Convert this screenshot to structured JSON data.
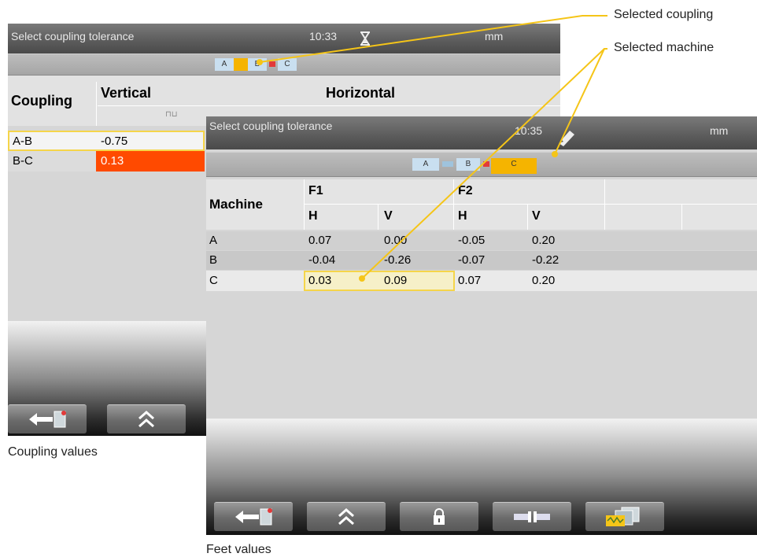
{
  "annotations": {
    "selected_coupling": "Selected coupling",
    "selected_machine": "Selected machine",
    "coupling_values": "Coupling values",
    "feet_values": "Feet values",
    "line_color": "#f5c518"
  },
  "screen1": {
    "title": "Select coupling tolerance",
    "time": "10:33",
    "unit": "mm",
    "machines": [
      "A",
      "B",
      "C"
    ],
    "selected_coupling": "A-B",
    "col_coupling": "Coupling",
    "col_vertical": "Vertical",
    "col_horizontal": "Horizontal",
    "rows": [
      {
        "coupling": "A-B",
        "value": "-0.75"
      },
      {
        "coupling": "B-C",
        "value": "0.13"
      }
    ],
    "alert_color": "#ff4a00",
    "buttons": [
      "back-icon",
      "up-chevrons-icon"
    ]
  },
  "screen2": {
    "title": "Select coupling tolerance",
    "time": "10:35",
    "unit": "mm",
    "machines": [
      "A",
      "B",
      "C"
    ],
    "selected_machine": "C",
    "col_machine": "Machine",
    "col_f1": "F1",
    "col_f2": "F2",
    "sub_h": "H",
    "sub_v": "V",
    "rows": [
      {
        "machine": "A",
        "f1h": "0.07",
        "f1v": "0.00",
        "f2h": "-0.05",
        "f2v": "0.20"
      },
      {
        "machine": "B",
        "f1h": "-0.04",
        "f1v": "-0.26",
        "f2h": "-0.07",
        "f2v": "-0.22"
      },
      {
        "machine": "C",
        "f1h": "0.03",
        "f1v": "0.09",
        "f2h": "0.07",
        "f2v": "0.20"
      }
    ],
    "buttons": [
      "back-icon",
      "up-chevrons-icon",
      "lock-icon",
      "coupling-icon",
      "tolerance-icon"
    ]
  }
}
